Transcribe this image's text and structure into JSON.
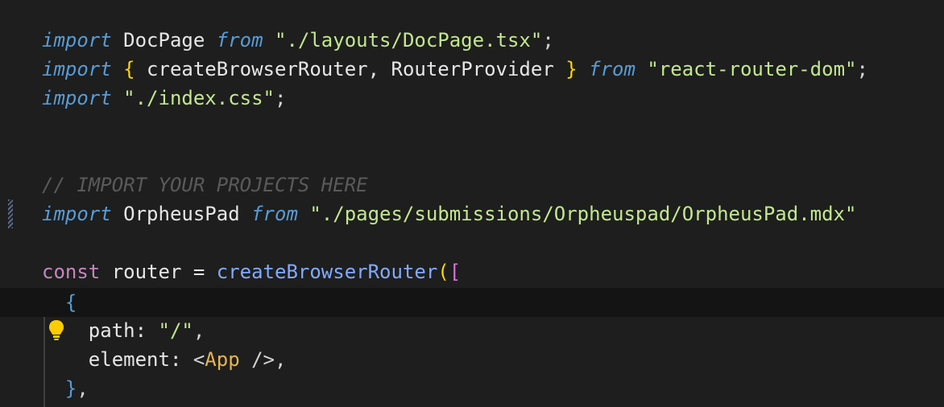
{
  "code": {
    "line1": {
      "kw": "import",
      "id": " DocPage ",
      "from": "from",
      "str": " \"./layouts/DocPage.tsx\"",
      "end": ";"
    },
    "line2": {
      "kw": "import",
      "open": " {",
      "ids": " createBrowserRouter, RouterProvider ",
      "close": "}",
      "from": " from",
      "str": " \"react-router-dom\"",
      "end": ";"
    },
    "line3": {
      "kw": "import",
      "str": " \"./index.css\"",
      "end": ";"
    },
    "comment": "// IMPORT YOUR PROJECTS HERE",
    "line5": {
      "kw": "import",
      "id": " OrpheusPad ",
      "from": "from",
      "str": " \"./pages/submissions/Orpheuspad/OrpheusPad.mdx\""
    },
    "line6": {
      "const": "const",
      "id": " router = ",
      "fn": "createBrowserRouter",
      "paren": "(",
      "bracket": "["
    },
    "line7": {
      "brace": "  {"
    },
    "line8": {
      "key": "    path: ",
      "str": "\"/\"",
      "end": ","
    },
    "line9": {
      "key": "    element: ",
      "lt": "<",
      "tag": "App",
      "gt": " />",
      "end": ","
    },
    "line10": {
      "brace": "  }",
      "end": ","
    }
  },
  "icons": {
    "lightbulb": "lightbulb-icon",
    "gutter": "modified-line-marker"
  },
  "colors": {
    "background": "#1e1e1e",
    "keyword": "#569cd6",
    "string": "#c3e88d",
    "function": "#82aaff",
    "bracket": "#ffd700",
    "comment": "#5a5a5a",
    "lightbulb": "#ffcc00"
  }
}
